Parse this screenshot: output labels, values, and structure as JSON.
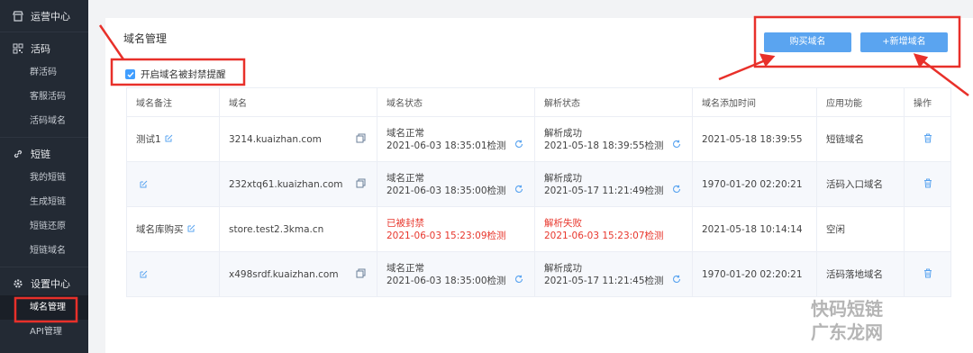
{
  "sidebar": {
    "groups": [
      {
        "label": "运营中心",
        "icon": "shop-icon",
        "items": []
      },
      {
        "label": "活码",
        "icon": "qrcode-icon",
        "items": [
          "群活码",
          "客服活码",
          "活码域名"
        ]
      },
      {
        "label": "短链",
        "icon": "link-icon",
        "items": [
          "我的短链",
          "生成短链",
          "短链还原",
          "短链域名"
        ]
      },
      {
        "label": "设置中心",
        "icon": "gear-icon",
        "items": [
          "域名管理",
          "API管理"
        ]
      }
    ],
    "active_item": "域名管理"
  },
  "page": {
    "title": "域名管理",
    "checkbox_label": "开启域名被封禁提醒",
    "checkbox_checked": true,
    "buy_button": "购买域名",
    "add_button": "+新增域名"
  },
  "table": {
    "headers": [
      "域名备注",
      "域名",
      "域名状态",
      "解析状态",
      "域名添加时间",
      "应用功能",
      "操作"
    ],
    "rows": [
      {
        "note": "测试1",
        "domain": "3214.kuaizhan.com",
        "status": "域名正常",
        "status_time": "2021-06-03 18:35:01检测",
        "parse": "解析成功",
        "parse_time": "2021-05-18 18:39:55检测",
        "added": "2021-05-18 18:39:55",
        "func": "短链域名",
        "error": false
      },
      {
        "note": "",
        "domain": "232xtq61.kuaizhan.com",
        "status": "域名正常",
        "status_time": "2021-06-03 18:35:00检测",
        "parse": "解析成功",
        "parse_time": "2021-05-17 11:21:49检测",
        "added": "1970-01-20 02:20:21",
        "func": "活码入口域名",
        "error": false
      },
      {
        "note": "域名库购买",
        "domain": "store.test2.3kma.cn",
        "status": "已被封禁",
        "status_time": "2021-06-03 15:23:09检测",
        "parse": "解析失败",
        "parse_time": "2021-06-03 15:23:07检测",
        "added": "2021-05-18 10:14:14",
        "func": "空闲",
        "error": true
      },
      {
        "note": "",
        "domain": "x498srdf.kuaizhan.com",
        "status": "域名正常",
        "status_time": "2021-06-03 18:35:00检测",
        "parse": "解析成功",
        "parse_time": "2021-05-17 11:21:45检测",
        "added": "1970-01-20 02:20:21",
        "func": "活码落地域名",
        "error": false
      }
    ]
  },
  "watermark": {
    "line1": "快码短链",
    "line2": "广东龙网"
  },
  "colors": {
    "accent": "#409eff",
    "button": "#5aa4f0",
    "error": "#e8372d",
    "annotation": "#e8302a",
    "sidebar": "#232a34"
  }
}
